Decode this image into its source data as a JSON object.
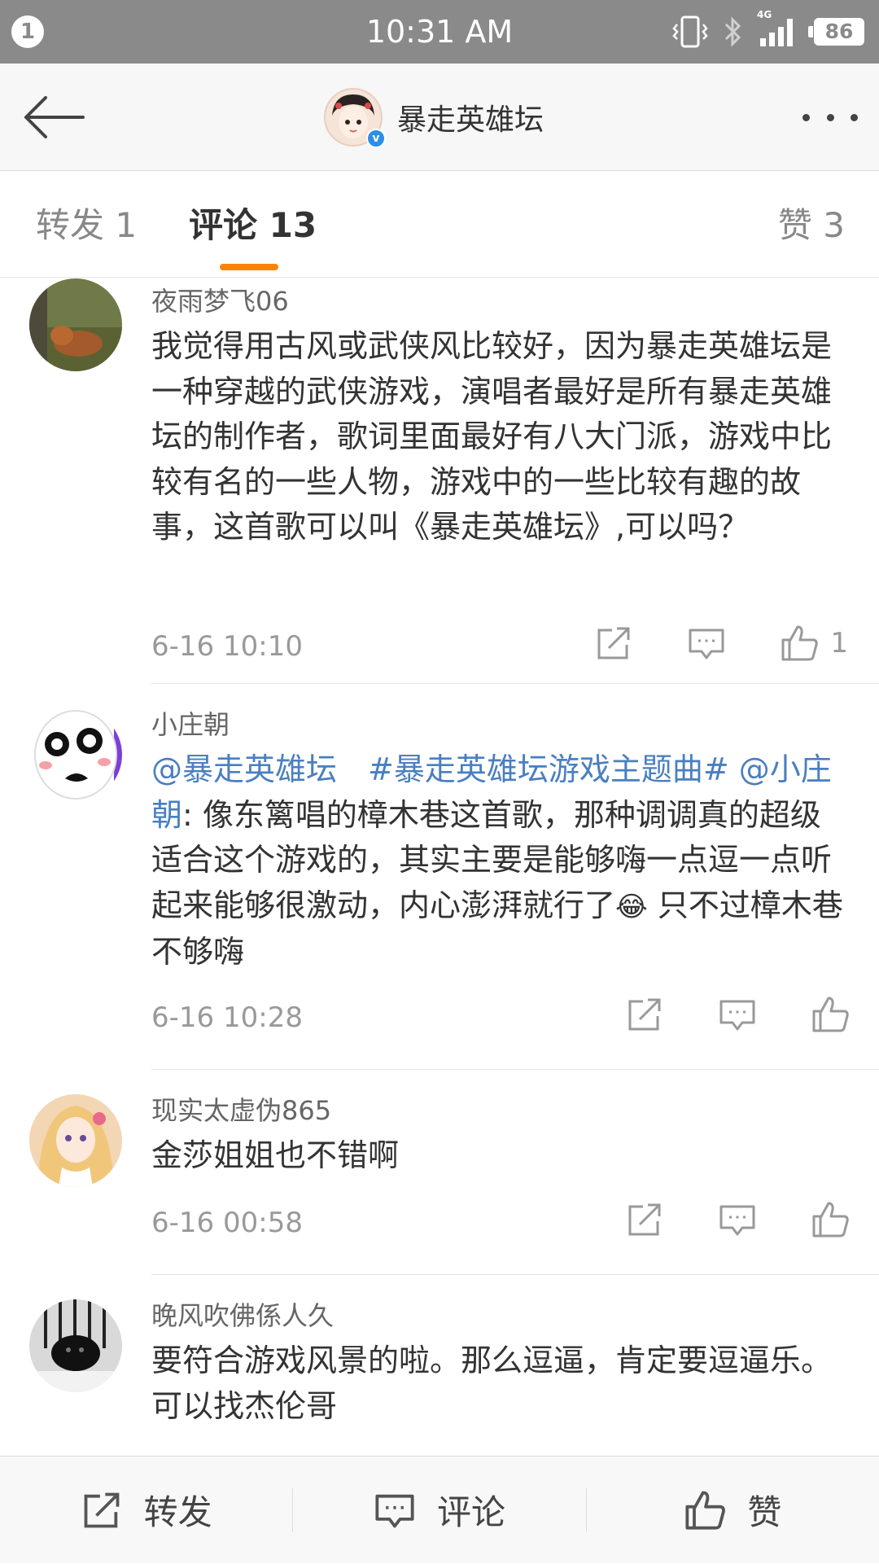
{
  "status_bar": {
    "notification_count": "1",
    "time": "10:31 AM",
    "network": "4G",
    "battery": "86"
  },
  "header": {
    "title": "暴走英雄坛",
    "verified_mark": "v"
  },
  "tabs": {
    "forward": "转发 1",
    "comment": "评论 13",
    "like": "赞 3"
  },
  "comments": [
    {
      "username": "夜雨梦飞06",
      "text": "我觉得用古风或武侠风比较好，因为暴走英雄坛是一种穿越的武侠游戏，演唱者最好是所有暴走英雄坛的制作者，歌词里面最好有八大门派，游戏中比较有名的一些人物，游戏中的一些比较有趣的故事，这首歌可以叫《暴走英雄坛》,可以吗？",
      "time": "6-16 10:10",
      "likes": "1"
    },
    {
      "username": "小庄朝",
      "mention_1": "@暴走英雄坛",
      "topic": "#暴走英雄坛游戏主题曲#",
      "mention_2": "@小庄朝",
      "text": ": 像东篱唱的樟木巷这首歌，那种调调真的超级适合这个游戏的，其实主要是能够嗨一点逗一点听起来能够很激动，内心澎湃就行了",
      "emoji": "😂",
      "text_after": " 只不过樟木巷不够嗨",
      "time": "6-16 10:28"
    },
    {
      "username": "现实太虚伪865",
      "text": "金莎姐姐也不错啊",
      "time": "6-16 00:58"
    },
    {
      "username": "晚风吹佛係人久",
      "text": "要符合游戏风景的啦。那么逗逼，肯定要逗逼乐。可以找杰伦哥"
    }
  ],
  "bottom_bar": {
    "forward": "转发",
    "comment": "评论",
    "like": "赞"
  },
  "icons": {
    "back": "back-arrow-icon",
    "more": "more-dots-icon",
    "share": "share-icon",
    "reply": "comment-icon",
    "like": "thumbs-up-icon"
  },
  "colors": {
    "accent": "#ff8200",
    "link": "#4a7fc1",
    "status_bar": "#8a8a8a"
  }
}
